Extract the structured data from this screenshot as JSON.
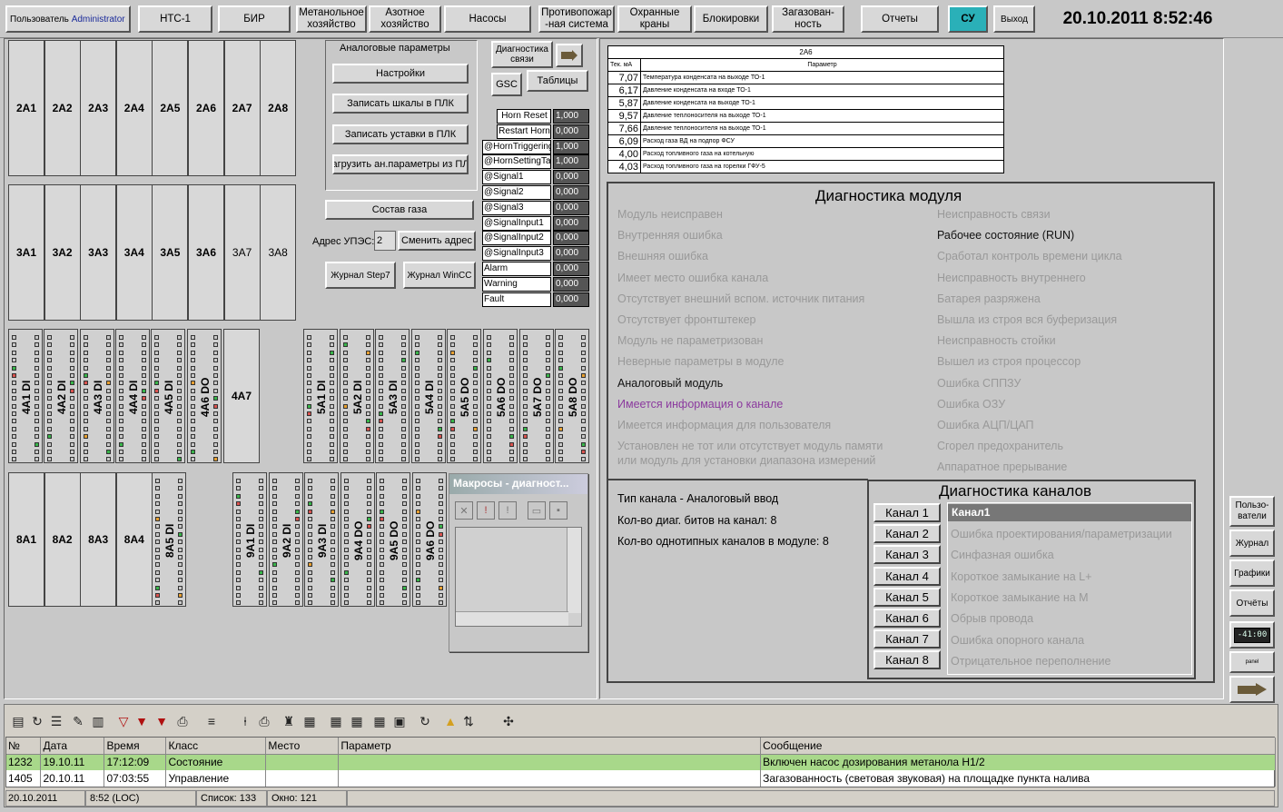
{
  "top": {
    "user_label": "Пользователь",
    "user_name": "Administrator",
    "nav": [
      {
        "l1": "НТС-1",
        "l2": ""
      },
      {
        "l1": "БИР",
        "l2": ""
      },
      {
        "l1": "Метанольное",
        "l2": "хозяйство"
      },
      {
        "l1": "Азотное",
        "l2": "хозяйство"
      },
      {
        "l1": "Насосы",
        "l2": ""
      },
      {
        "l1": "Противопожар",
        "l2": "-ная система"
      },
      {
        "l1": "Охранные",
        "l2": "краны"
      },
      {
        "l1": "Блокировки",
        "l2": ""
      },
      {
        "l1": "Загазован-",
        "l2": "ность"
      },
      {
        "l1": "Отчеты",
        "l2": ""
      },
      {
        "l1": "СУ",
        "l2": ""
      },
      {
        "l1": "Выход",
        "l2": ""
      }
    ],
    "datetime": "20.10.2011 8:52:46"
  },
  "racks": {
    "r2": [
      "2A1",
      "2A2",
      "2A3",
      "2A4",
      "2A5",
      "2A6",
      "2A7",
      "2A8"
    ],
    "r3": [
      "3A1",
      "3A2",
      "3A3",
      "3A4",
      "3A5",
      "3A6",
      "3A7",
      "3A8"
    ],
    "r4": [
      "4A1 DI",
      "4A2 DI",
      "4A3 DI",
      "4A4 DI",
      "4A5 DI",
      "4A6 DO"
    ],
    "r4x": "4A7",
    "r5": [
      "5A1 DI",
      "5A2 DI",
      "5A3 DI",
      "5A4 DI",
      "5A5 DO",
      "5A6 DO",
      "5A7 DO",
      "5A8 DO"
    ],
    "r8": [
      "8A1",
      "8A2",
      "8A3",
      "8A4"
    ],
    "r8s": "8A5 DI",
    "r9": [
      "9A1 DI",
      "9A2 DI",
      "9A3 DI",
      "9A4 DO",
      "9A5 DO",
      "9A6 DO"
    ]
  },
  "analog": {
    "title": "Аналоговые параметры",
    "settings": "Настройки",
    "write_scales": "Записать шкалы в ПЛК",
    "write_setpoints": "Записать уставки в ПЛК",
    "load_params": "агрузить ан.параметры из ПЛ",
    "gas": "Состав газа",
    "addr_label": "Адрес УПЭС:",
    "addr_value": "2",
    "change_addr": "Сменить адрес",
    "journal_step7": "Журнал Step7",
    "journal_wincc": "Журнал WinCC"
  },
  "diag": {
    "diag_conn": "Диагностика связи",
    "gsc": "GSC",
    "tables": "Таблицы"
  },
  "signals": [
    {
      "name": "Horn Reset",
      "value": "1,000"
    },
    {
      "name": "Restart Horn",
      "value": "0,000"
    },
    {
      "name": "@HornTriggering",
      "value": "1,000"
    },
    {
      "name": "@HornSettingTa",
      "value": "1,000"
    },
    {
      "name": "@Signal1",
      "value": "0,000"
    },
    {
      "name": "@Signal2",
      "value": "0,000"
    },
    {
      "name": "@Signal3",
      "value": "0,000"
    },
    {
      "name": "@SignalInput1",
      "value": "0,000"
    },
    {
      "name": "@SignalInput2",
      "value": "0,000"
    },
    {
      "name": "@SignalInput3",
      "value": "0,000"
    },
    {
      "name": "Alarm",
      "value": "0,000"
    },
    {
      "name": "Warning",
      "value": "0,000"
    },
    {
      "name": "Fault",
      "value": "0,000"
    }
  ],
  "macros": {
    "title": "Макросы - диагност..."
  },
  "table2a6": {
    "title": "2A6",
    "col1": "Тек. мА",
    "col2": "Параметр",
    "rows": [
      {
        "v": "7,07",
        "p": "Температура конденсата на выходе ТО-1"
      },
      {
        "v": "6,17",
        "p": "Давление конденсата на входе ТО-1"
      },
      {
        "v": "5,87",
        "p": "Давление конденсата на выходе ТО-1"
      },
      {
        "v": "9,57",
        "p": "Давление теплоносителя на выходе ТО-1"
      },
      {
        "v": "7,66",
        "p": "Давление теплоносителя на выходе ТО-1"
      },
      {
        "v": "6,09",
        "p": "Расход газа ВД на подпор ФСУ"
      },
      {
        "v": "4,00",
        "p": "Расход топливного газа на котельную"
      },
      {
        "v": "4,03",
        "p": "Расход топливного газа на горелки ГФУ-5"
      }
    ]
  },
  "module_diag": {
    "title": "Диагностика модуля",
    "left": [
      {
        "t": "Модуль неисправен",
        "s": "off"
      },
      {
        "t": "Внутренняя ошибка",
        "s": "off"
      },
      {
        "t": "Внешняя ошибка",
        "s": "off"
      },
      {
        "t": "Имеет место ошибка канала",
        "s": "off"
      },
      {
        "t": "Отсутствует внешний вспом. источник питания",
        "s": "off"
      },
      {
        "t": "Отсутствует фронтштекер",
        "s": "off"
      },
      {
        "t": "Модуль не параметризован",
        "s": "off"
      },
      {
        "t": "Неверные параметры в модуле",
        "s": "off"
      },
      {
        "t": "Аналоговый модуль",
        "s": "on"
      },
      {
        "t": "Имеется информация о канале",
        "s": "info"
      },
      {
        "t": "Имеется информация для пользователя",
        "s": "off"
      },
      {
        "t": "Установлен не тот или отсутствует модуль памяти",
        "s": "off"
      },
      {
        "t": "или модуль для установки диапазона измерений",
        "s": "off"
      }
    ],
    "right": [
      {
        "t": "Неисправность связи",
        "s": "off"
      },
      {
        "t": "Рабочее состояние (RUN)",
        "s": "on"
      },
      {
        "t": "Сработал контроль времени цикла",
        "s": "off"
      },
      {
        "t": "Неисправность внутреннего",
        "s": "off"
      },
      {
        "t": "Батарея разряжена",
        "s": "off"
      },
      {
        "t": "Вышла из строя вся буферизация",
        "s": "off"
      },
      {
        "t": "Неисправность стойки",
        "s": "off"
      },
      {
        "t": "Вышел из строя процессор",
        "s": "off"
      },
      {
        "t": "Ошибка СППЗУ",
        "s": "off"
      },
      {
        "t": "Ошибка ОЗУ",
        "s": "off"
      },
      {
        "t": "Ошибка АЦП/ЦАП",
        "s": "off"
      },
      {
        "t": "Сгорел предохранитель",
        "s": "off"
      },
      {
        "t": "Аппаратное прерывание",
        "s": "off"
      }
    ],
    "channel_type": "Тип канала -  Аналоговый ввод",
    "bits": "Кол-во диаг. битов на канал:  8",
    "same_channels": "Кол-во однотипных каналов в модуле: 8"
  },
  "channel_diag": {
    "title": "Диагностика каналов",
    "buttons": [
      "Канал 1",
      "Канал 2",
      "Канал 3",
      "Канал 4",
      "Канал 5",
      "Канал 6",
      "Канал 7",
      "Канал 8"
    ],
    "header": "Канал1",
    "items": [
      "Ошибка проектирования/параметризации",
      "Синфазная ошибка",
      "Короткое замыкание на L+",
      "Короткое замыкание на М",
      "Обрыв провода",
      "Ошибка опорного канала",
      "Отрицательное переполнение"
    ]
  },
  "right_panel": {
    "users": "Пользо- ватели",
    "journal": "Журнал",
    "graphs": "Графики",
    "reports": "Отчёты",
    "clock": "-41:00",
    "panel": "panel"
  },
  "events": {
    "headers": [
      "№",
      "Дата",
      "Время",
      "Класс",
      "Место",
      "Параметр",
      "Сообщение"
    ],
    "rows": [
      {
        "n": "1232",
        "d": "19.10.11",
        "t": "17:12:09",
        "c": "Состояние",
        "p": "",
        "par": "",
        "m": "Включен насос дозирования метанола Н1/2"
      },
      {
        "n": "1405",
        "d": "20.10.11",
        "t": "07:03:55",
        "c": "Управление",
        "p": "",
        "par": "",
        "m": "Загазованность (световая звуковая) на площадке пункта налива"
      }
    ]
  },
  "status": {
    "date": "20.10.2011",
    "time": "8:52 (LOC)",
    "list": "Список: 133",
    "window": "Окно: 121"
  },
  "colors": {
    "bg": "#c8c8c8",
    "event_row": "#a8d88a",
    "su_button": "#2ab0b8",
    "led_green": "#39b54a",
    "led_red": "#d9534f",
    "led_orange": "#e8a030",
    "info_purple": "#8b3a9e"
  }
}
